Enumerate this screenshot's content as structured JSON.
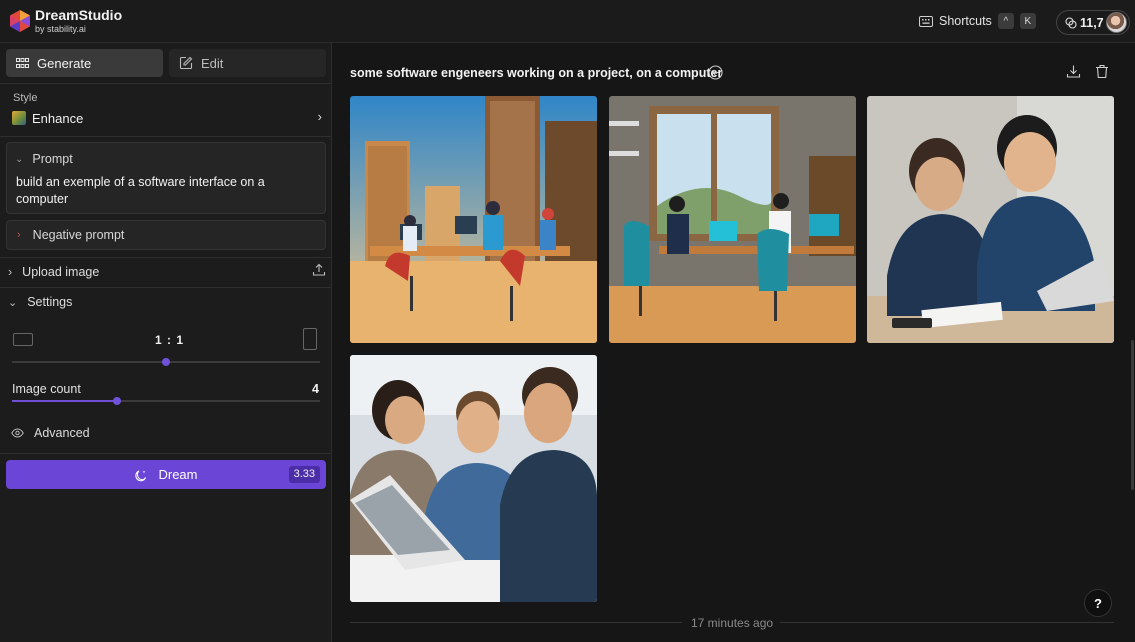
{
  "app": {
    "name": "DreamStudio",
    "subtitle": "by stability.ai"
  },
  "topbar": {
    "shortcuts_label": "Shortcuts",
    "key1": "^",
    "key2": "K",
    "credits": "11,7"
  },
  "sidebar": {
    "tabs": [
      {
        "label": "Generate",
        "active": true
      },
      {
        "label": "Edit",
        "active": false
      }
    ],
    "style": {
      "label": "Style",
      "value": "Enhance"
    },
    "prompt": {
      "label": "Prompt",
      "text": "build an exemple of a software interface on a computer"
    },
    "negative_prompt": {
      "label": "Negative prompt"
    },
    "upload": {
      "label": "Upload image"
    },
    "settings": {
      "label": "Settings",
      "aspect_ratio": "1 : 1",
      "aspect_slider_fraction": 0.5,
      "image_count_label": "Image count",
      "image_count": "4",
      "image_count_fraction": 0.34,
      "advanced_label": "Advanced"
    },
    "dream_button": {
      "label": "Dream",
      "cost": "3.33"
    }
  },
  "main": {
    "prompt_title": "some software engeneers working on a project, on a computer",
    "timestamp": "17 minutes ago",
    "help": "?",
    "images": [
      {
        "name": "illustration-engineers-city"
      },
      {
        "name": "illustration-engineers-office"
      },
      {
        "name": "photo-two-engineers-laptop"
      },
      {
        "name": "photo-three-engineers-laptop"
      }
    ]
  },
  "colors": {
    "accent": "#6b46d6",
    "background": "#161616",
    "panel": "#1c1c1c"
  }
}
